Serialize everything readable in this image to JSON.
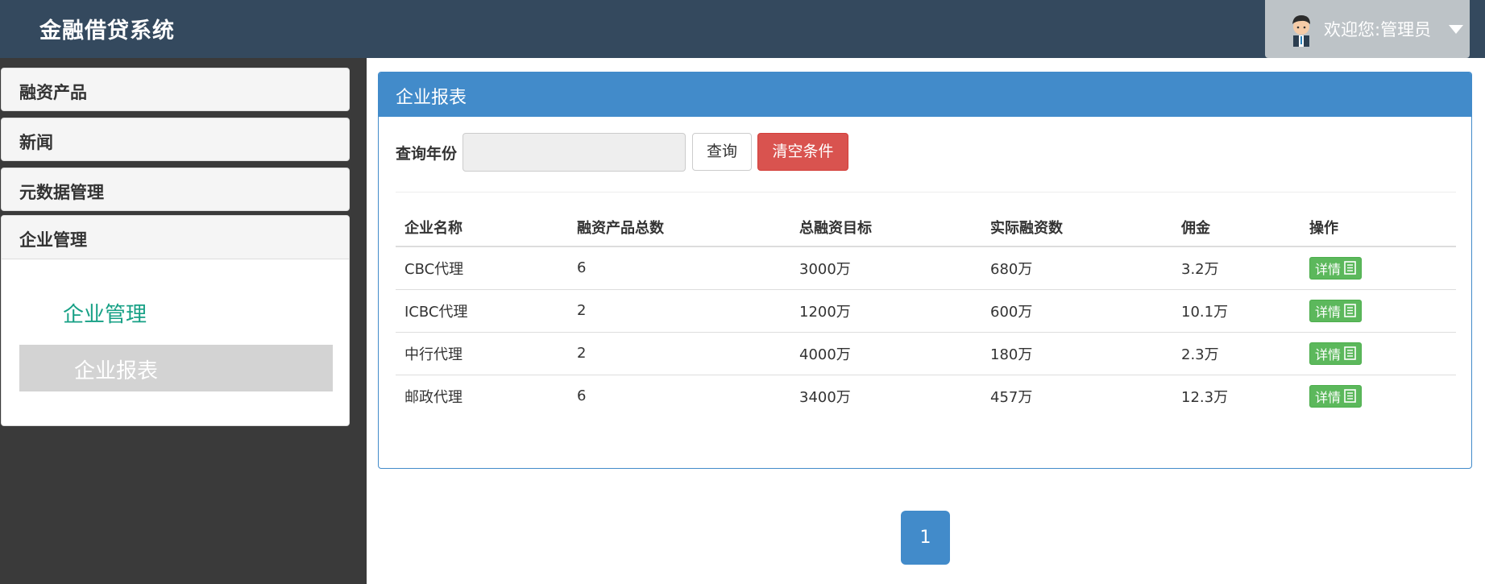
{
  "header": {
    "brand": "金融借贷系统",
    "welcome": "欢迎您:管理员"
  },
  "sidebar": {
    "items": [
      {
        "label": "融资产品"
      },
      {
        "label": "新闻"
      },
      {
        "label": "元数据管理"
      },
      {
        "label": "企业管理"
      }
    ],
    "submenu": [
      {
        "label": "企业管理"
      },
      {
        "label": "企业报表"
      }
    ]
  },
  "panel": {
    "title": "企业报表",
    "query_label": "查询年份",
    "query_value": "",
    "query_button": "查询",
    "clear_button": "清空条件"
  },
  "table": {
    "headers": [
      "企业名称",
      "融资产品总数",
      "总融资目标",
      "实际融资数",
      "佣金",
      "操作"
    ],
    "rows": [
      [
        "CBC代理",
        "6",
        "3000万",
        "680万",
        "3.2万",
        "详情"
      ],
      [
        "ICBC代理",
        "2",
        "1200万",
        "600万",
        "10.1万",
        "详情"
      ],
      [
        "中行代理",
        "2",
        "4000万",
        "180万",
        "2.3万",
        "详情"
      ],
      [
        "邮政代理",
        "6",
        "3400万",
        "457万",
        "12.3万",
        "详情"
      ]
    ]
  },
  "pagination": {
    "current": "1"
  },
  "colors": {
    "header_bg": "#34495e",
    "panel_primary": "#428bca",
    "danger": "#d9534f",
    "success": "#5cb85c",
    "submenu_link": "#16a085"
  },
  "icons": {
    "avatar": "user-avatar-icon",
    "dropdown": "caret-down-icon",
    "detail": "document-list-icon"
  }
}
